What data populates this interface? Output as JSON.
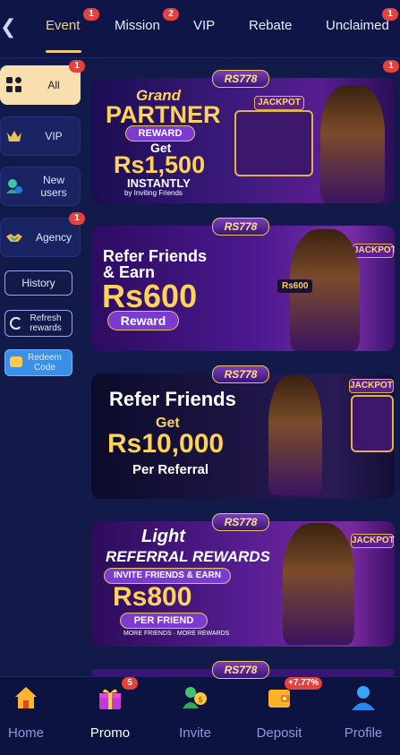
{
  "header": {
    "back_icon": "chevron-left-icon",
    "tabs": [
      {
        "label": "Event",
        "badge": "1",
        "active": true
      },
      {
        "label": "Mission",
        "badge": "2",
        "active": false
      },
      {
        "label": "VIP",
        "badge": "",
        "active": false
      },
      {
        "label": "Rebate",
        "badge": "",
        "active": false
      },
      {
        "label": "Unclaimed",
        "badge": "1",
        "active": false
      }
    ],
    "accent": "#f0c77a"
  },
  "sidebar": {
    "items": [
      {
        "label": "All",
        "badge": "1",
        "icon": "grid-icon",
        "active": true
      },
      {
        "label": "VIP",
        "badge": "",
        "icon": "crown-icon",
        "active": false
      },
      {
        "label": "New users",
        "badge": "",
        "icon": "new-user-icon",
        "active": false
      },
      {
        "label": "Agency",
        "badge": "1",
        "icon": "handshake-icon",
        "active": false
      }
    ],
    "history_label": "History",
    "refresh_label": "Refresh rewards",
    "redeem_label": "Redeem Code"
  },
  "banners": {
    "corner_badge": "1",
    "brand": "RS778",
    "b1": {
      "line1": "Grand",
      "line2": "PARTNER",
      "pill": "REWARD",
      "line3": "Get",
      "amount": "Rs1,500",
      "line4": "INSTANTLY",
      "line5": "by Inviting Friends",
      "sign": "JACKPOT"
    },
    "b2": {
      "line1": "Refer Friends",
      "line2": "& Earn",
      "amount": "Rs600",
      "pill": "Reward",
      "card": "Rs600",
      "sign": "JACKPOT"
    },
    "b3": {
      "line1": "Refer Friends",
      "line2": "Get",
      "amount": "Rs10,000",
      "line3": "Per Referral",
      "sign": "JACKPOT"
    },
    "b4": {
      "line1": "Light",
      "line2": "REFERRAL REWARDS",
      "pill": "INVITE FRIENDS & EARN",
      "amount": "Rs800",
      "pill2": "PER FRIEND",
      "line3": "MORE FRIENDS · MORE REWARDS",
      "sign": "JACKPOT"
    }
  },
  "nav": {
    "items": [
      {
        "label": "Home",
        "icon": "home-icon",
        "badge": ""
      },
      {
        "label": "Promo",
        "icon": "gift-icon",
        "badge": "5",
        "active": true
      },
      {
        "label": "Invite",
        "icon": "invite-icon",
        "badge": ""
      },
      {
        "label": "Deposit",
        "icon": "wallet-icon",
        "badge": "+7.77%"
      },
      {
        "label": "Profile",
        "icon": "profile-icon",
        "badge": ""
      }
    ]
  }
}
